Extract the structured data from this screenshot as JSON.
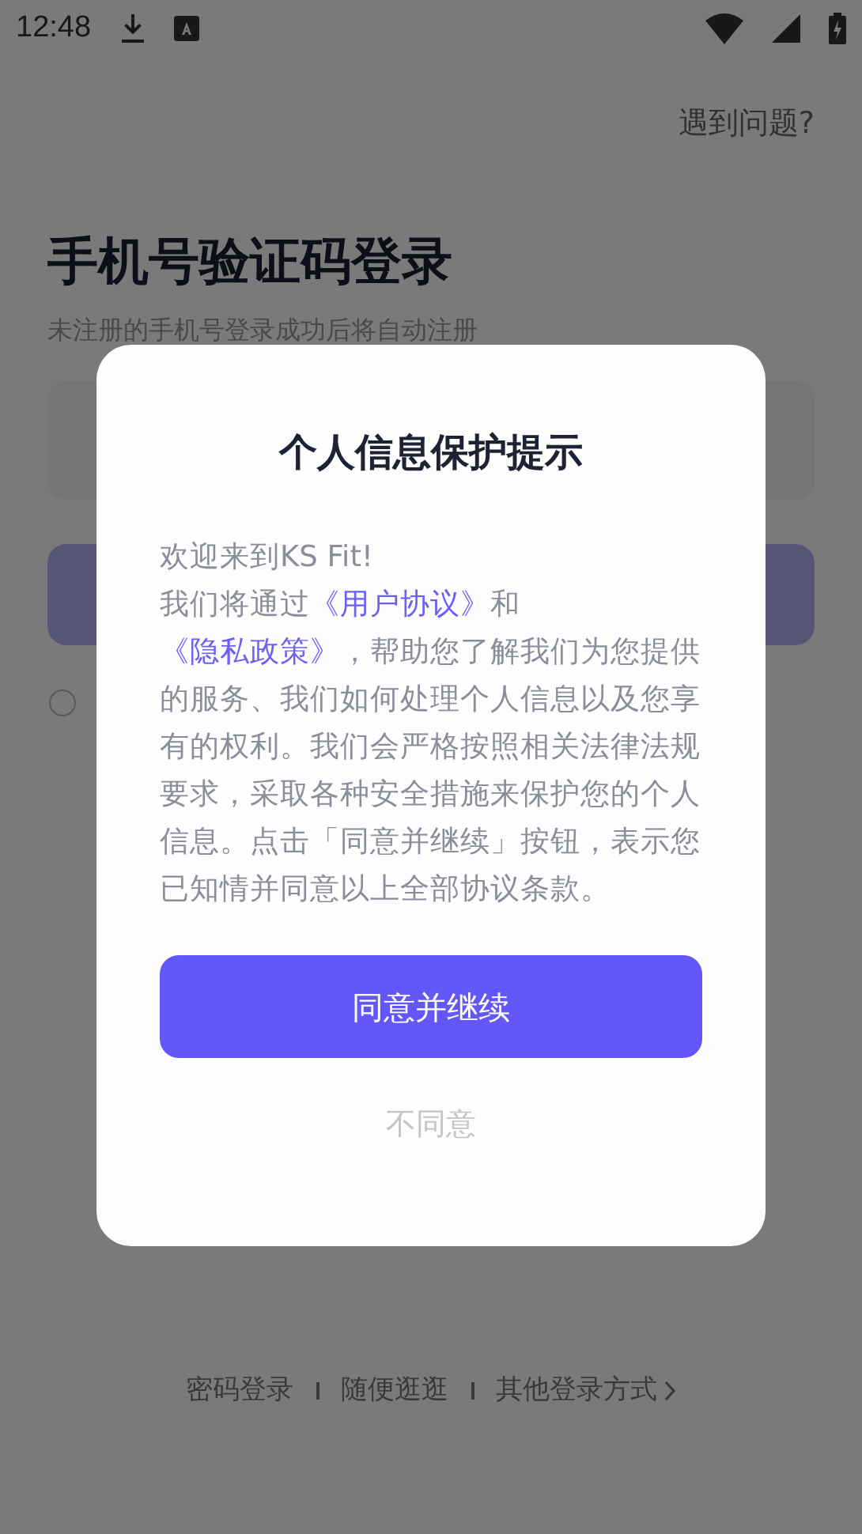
{
  "status_bar": {
    "time": "12:48"
  },
  "page": {
    "help_link": "遇到问题?",
    "title": "手机号验证码登录",
    "subtitle": "未注册的手机号登录成功后将自动注册",
    "agree_checkbox": {
      "checked": false
    },
    "bottom_links": [
      {
        "label": "密码登录",
        "kind": "plain"
      },
      {
        "label": "随便逛逛",
        "kind": "plain"
      },
      {
        "label": "其他登录方式",
        "kind": "more"
      }
    ]
  },
  "dialog": {
    "title": "个人信息保护提示",
    "greeting": "欢迎来到KS Fit!",
    "body": [
      {
        "text": "我们将通过",
        "kind": "plain"
      },
      {
        "text": "《用户协议》",
        "kind": "link"
      },
      {
        "text": "和",
        "kind": "plain"
      },
      {
        "text": "《隐私政策》",
        "kind": "link"
      },
      {
        "text": "，帮助您了解我们为您提供的服务、我们如何处理个人信息以及您享有的权利。我们会严格按照相关法律法规要求，采取各种安全措施来保护您的个人信息。点击「同意并继续」按钮，表示您已知情并同意以上全部协议条款。",
        "kind": "plain"
      }
    ],
    "accept_button": "同意并继续",
    "decline_button": "不同意"
  }
}
